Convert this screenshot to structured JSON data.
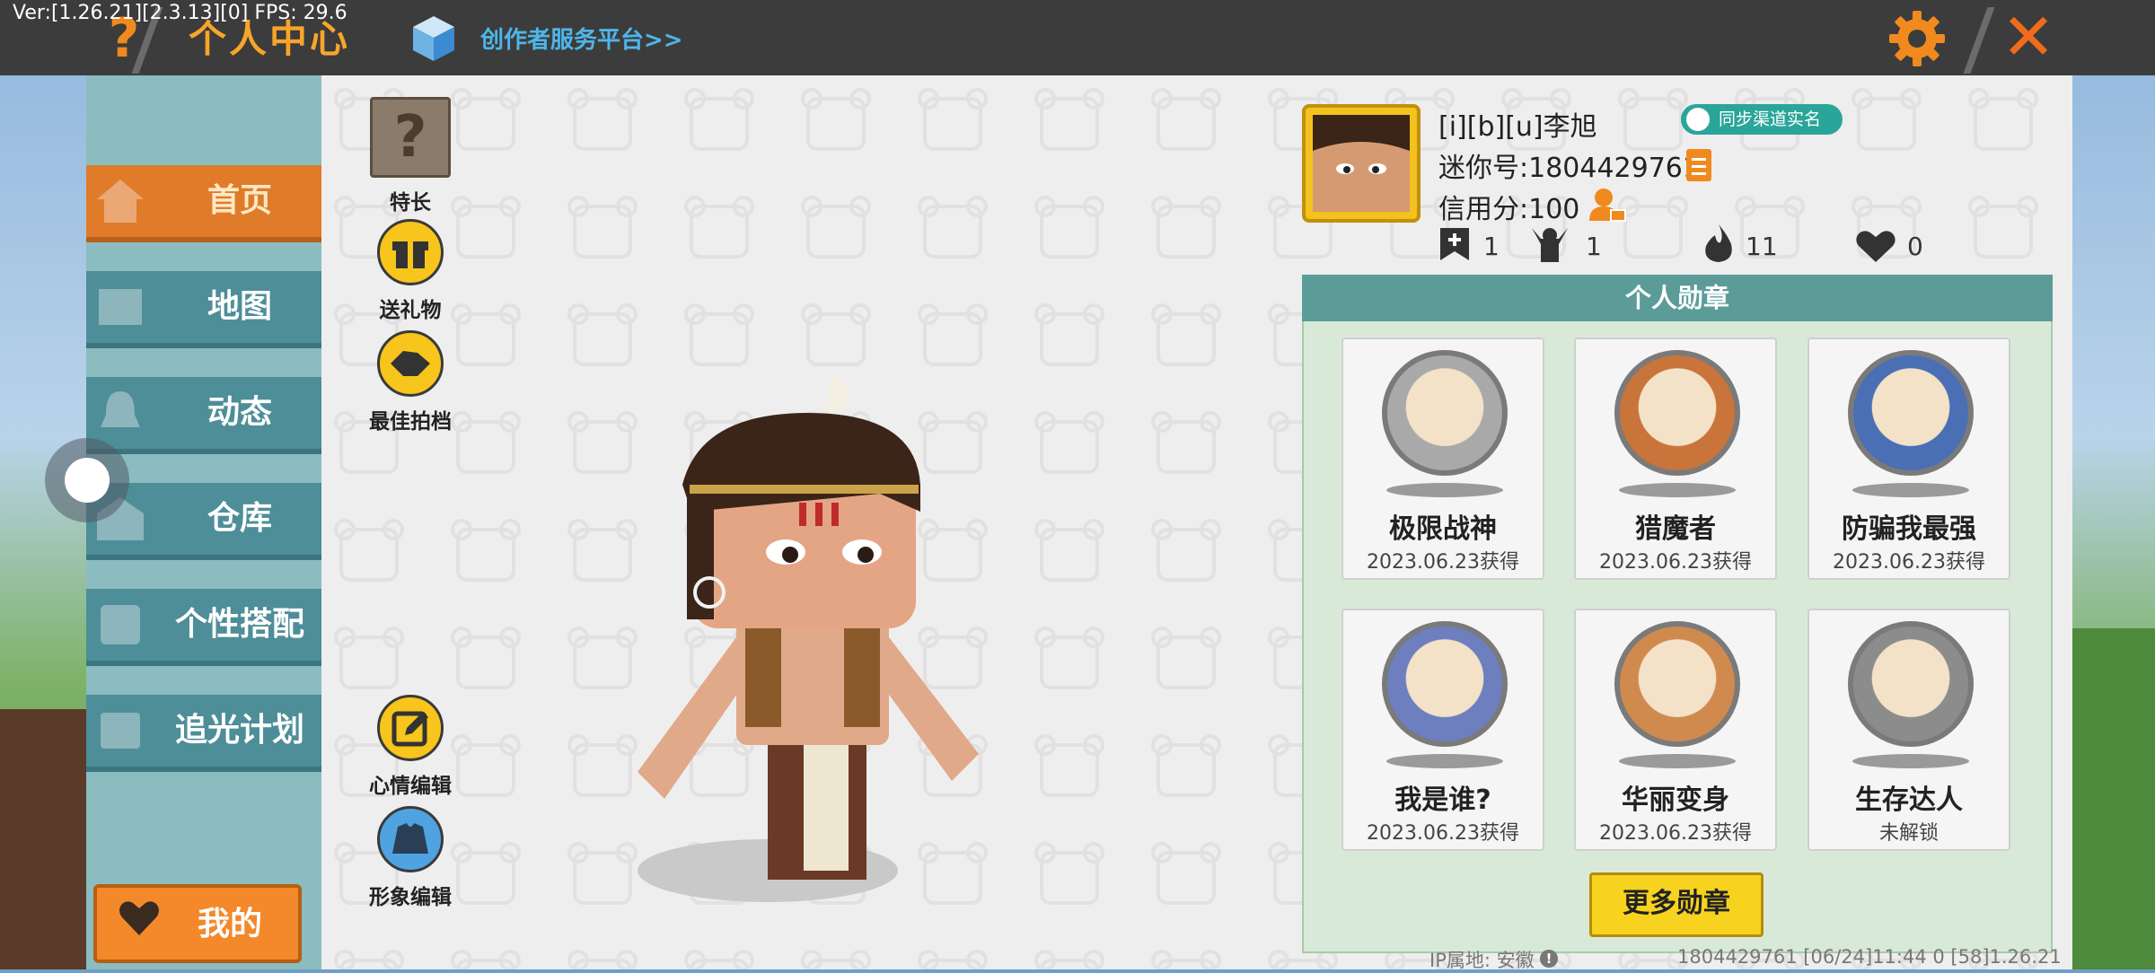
{
  "debug": {
    "version": "Ver:[1.26.21][2.3.13][0] FPS: 29.6"
  },
  "header": {
    "help_icon": "?",
    "title": "个人中心",
    "creator_link": "创作者服务平台>>",
    "settings_icon": "gear-icon",
    "close_icon": "✕"
  },
  "sidebar": {
    "items": [
      {
        "label": "首页",
        "icon": "home-icon",
        "active": true
      },
      {
        "label": "地图",
        "icon": "map-icon",
        "active": false
      },
      {
        "label": "动态",
        "icon": "bell-icon",
        "active": false
      },
      {
        "label": "仓库",
        "icon": "warehouse-icon",
        "active": false
      },
      {
        "label": "个性搭配",
        "icon": "outfit-icon",
        "active": false
      },
      {
        "label": "追光计划",
        "icon": "plan-icon",
        "active": false
      }
    ],
    "mine_label": "我的"
  },
  "side_actions": {
    "specialty": {
      "label": "特长",
      "icon": "?"
    },
    "gift": {
      "label": "送礼物"
    },
    "best_photo": {
      "label": "最佳拍档"
    },
    "mood_edit": {
      "label": "心情编辑"
    },
    "image_edit": {
      "label": "形象编辑"
    }
  },
  "profile": {
    "name": "[i][b][u]李旭",
    "mini_id": "迷你号:1804429761",
    "credit": "信用分:100",
    "realname_badge": "同步渠道实名",
    "stats": [
      {
        "icon": "add-friend-icon",
        "value": "1"
      },
      {
        "icon": "fans-icon",
        "value": "1"
      },
      {
        "icon": "fire-icon",
        "value": "11"
      },
      {
        "icon": "heart-icon",
        "value": "0"
      }
    ]
  },
  "medals": {
    "title": "个人勋章",
    "items": [
      {
        "name": "极限战神",
        "date": "2023.06.23获得",
        "color": "#a9a9a9"
      },
      {
        "name": "猎魔者",
        "date": "2023.06.23获得",
        "color": "#c9743a"
      },
      {
        "name": "防骗我最强",
        "date": "2023.06.23获得",
        "color": "#4a6fb5"
      },
      {
        "name": "我是谁?",
        "date": "2023.06.23获得",
        "color": "#6d7fbf"
      },
      {
        "name": "华丽变身",
        "date": "2023.06.23获得",
        "color": "#d08a4e"
      },
      {
        "name": "生存达人",
        "date": "未解锁",
        "color": "#8c8c8c"
      }
    ],
    "more_label": "更多勋章"
  },
  "footer": {
    "ip": "IP属地: 安徽",
    "meta": "1804429761   [06/24]11:44 0   [58]1.26.21"
  }
}
